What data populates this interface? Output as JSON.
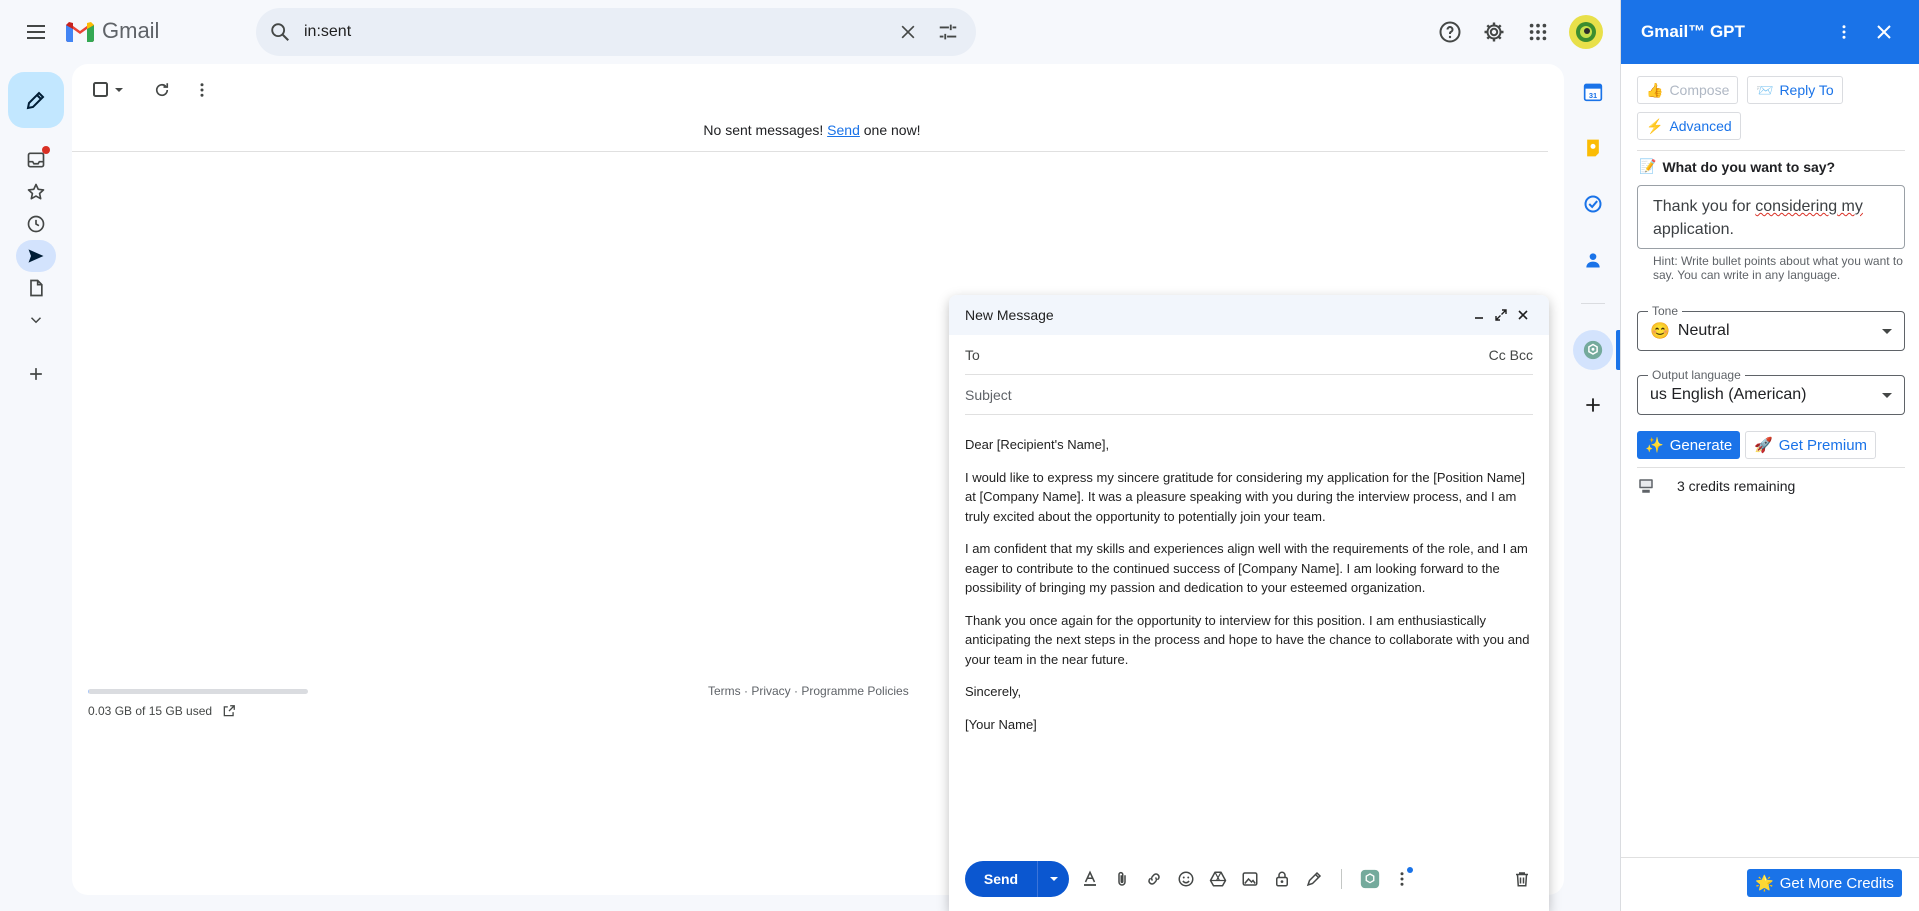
{
  "app": {
    "name": "Gmail"
  },
  "search": {
    "query": "in:sent"
  },
  "main": {
    "empty_prefix": "No sent messages!",
    "empty_link": "Send",
    "empty_suffix": "one now!",
    "storage": "0.03 GB of 15 GB used",
    "storage_fraction": 0.002,
    "footer": {
      "terms": "Terms",
      "sep": " · ",
      "privacy": "Privacy",
      "policies": "Programme Policies"
    }
  },
  "compose": {
    "title": "New Message",
    "to_label": "To",
    "cc_bcc": "Cc Bcc",
    "subject_placeholder": "Subject",
    "body": [
      "Dear [Recipient's Name],",
      "I would like to express my sincere gratitude for considering my application for the [Position Name] at [Company Name]. It was a pleasure speaking with you during the interview process, and I am truly excited about the opportunity to potentially join your team.",
      "I am confident that my skills and experiences align well with the requirements of the role, and I am eager to contribute to the continued success of [Company Name]. I am looking forward to the possibility of bringing my passion and dedication to your esteemed organization.",
      "Thank you once again for the opportunity to interview for this position. I am enthusiastically anticipating the next steps in the process and hope to have the chance to collaborate with you and your team in the near future.",
      "Sincerely,",
      "[Your Name]"
    ],
    "send_label": "Send"
  },
  "gpt": {
    "title": "Gmail™ GPT",
    "compose_btn": "Compose",
    "reply_btn": "Reply To",
    "advanced_btn": "Advanced",
    "prompt_label": "What do you want to say?",
    "prompt_value_1": "Thank you for ",
    "prompt_value_2": "considering",
    "prompt_value_3": " my",
    "prompt_value_4": "application.",
    "hint": "Hint: Write bullet points about what you want to say. You can write in any language.",
    "tone_label": "Tone",
    "tone_value": "Neutral",
    "language_label": "Output language",
    "language_value": "us English (American)",
    "generate_btn": "Generate",
    "premium_btn": "Get Premium",
    "credits": "3 credits remaining",
    "more_credits_btn": "Get More Credits"
  },
  "colors": {
    "accent": "#1a73e8",
    "compose_fab": "#c2e7ff",
    "send": "#0b57d0"
  }
}
